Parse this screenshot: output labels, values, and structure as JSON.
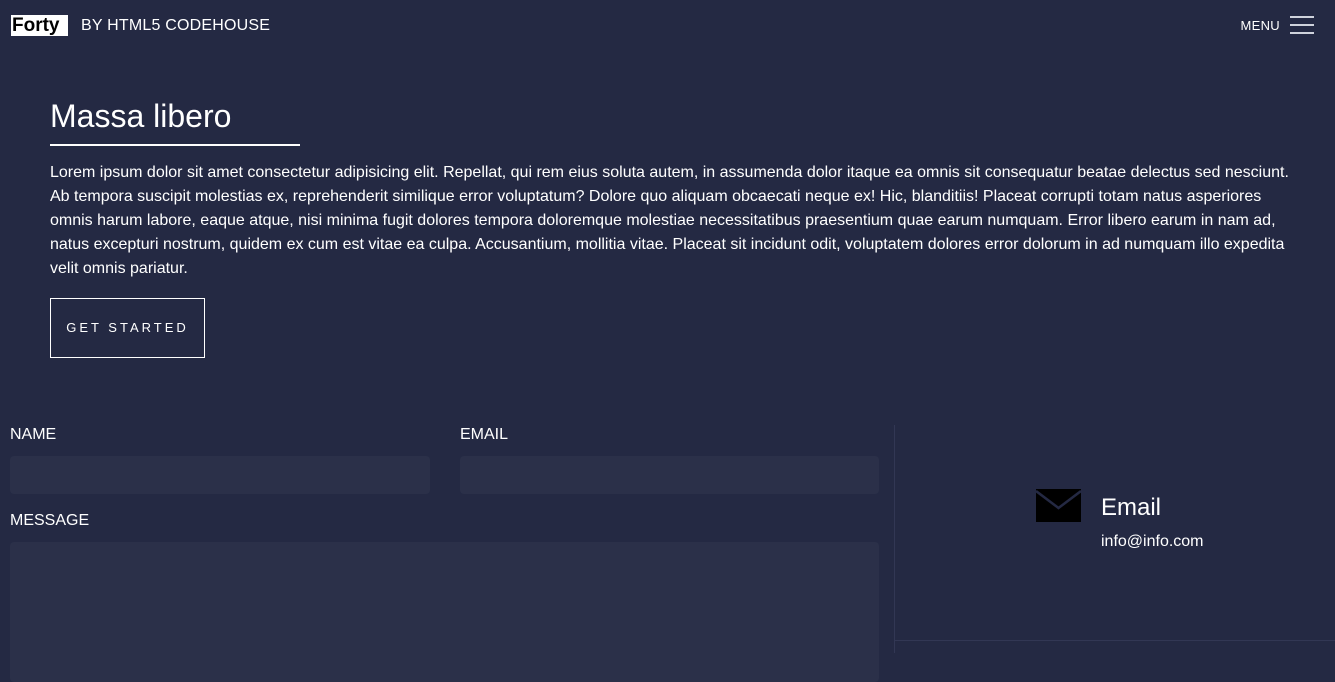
{
  "header": {
    "logo": "Forty",
    "byline": "BY HTML5 CODEHOUSE",
    "menu_label": "MENU",
    "menu_icon": "hamburger-icon"
  },
  "hero": {
    "title": "Massa libero",
    "text": "Lorem ipsum dolor sit amet consectetur adipisicing elit. Repellat, qui rem eius soluta autem, in assumenda dolor itaque ea omnis sit consequatur beatae delectus sed nesciunt. Ab tempora suscipit molestias ex, reprehenderit similique error voluptatum? Dolore quo aliquam obcaecati neque ex! Hic, blanditiis! Placeat corrupti totam natus asperiores omnis harum labore, eaque atque, nisi minima fugit dolores tempora doloremque molestiae necessitatibus praesentium quae earum numquam. Error libero earum in nam ad, natus excepturi nostrum, quidem ex cum est vitae ea culpa. Accusantium, mollitia vitae. Placeat sit incidunt odit, voluptatem dolores error dolorum in ad numquam illo expedita velit omnis pariatur.",
    "cta_label": "GET STARTED"
  },
  "form": {
    "name_label": "NAME",
    "name_value": "",
    "email_label": "EMAIL",
    "email_value": "",
    "message_label": "MESSAGE",
    "message_value": ""
  },
  "contact": {
    "icon": "envelope-icon",
    "title": "Email",
    "value": "info@info.com"
  },
  "colors": {
    "background": "#242943",
    "field": "#2b3049",
    "divider": "#323754",
    "text": "#ffffff"
  }
}
